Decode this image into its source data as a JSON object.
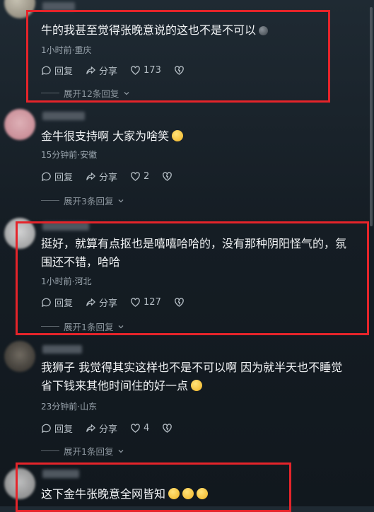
{
  "comments": [
    {
      "text": "牛的我甚至觉得张晚意说的这也不是不可以",
      "meta": "1小时前·重庆",
      "reply": "回复",
      "share": "分享",
      "likes": "173",
      "expand": "展开12条回复"
    },
    {
      "text": "金牛很支持啊 大家为啥笑",
      "meta": "15分钟前·安徽",
      "reply": "回复",
      "share": "分享",
      "likes": "2",
      "expand": "展开3条回复"
    },
    {
      "text_line1": "挺好，就算有点抠也是嘻嘻哈哈的，没有那种阴阳怪气的，氛",
      "text_line2": "围还不错，哈哈",
      "meta": "1小时前·河北",
      "reply": "回复",
      "share": "分享",
      "likes": "127",
      "expand": "展开1条回复"
    },
    {
      "text_line1": "我狮子 我觉得其实这样也不是不可以啊 因为就半天也不睡觉",
      "text_line2": "省下钱来其他时间住的好一点",
      "meta": "23分钟前·山东",
      "reply": "回复",
      "share": "分享",
      "likes": "4",
      "expand": "展开1条回复"
    },
    {
      "text": "这下金牛张晚意全网皆知"
    }
  ],
  "colors": {
    "highlight_border": "#e5242a",
    "background": "#151d24"
  },
  "icons": [
    "reply-icon",
    "share-icon",
    "heart-icon",
    "dislike-icon",
    "chevron-down-icon"
  ]
}
